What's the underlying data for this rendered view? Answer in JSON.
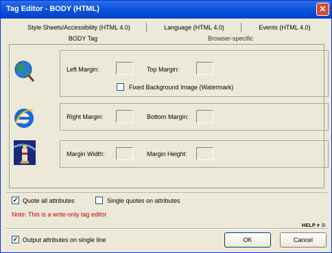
{
  "window": {
    "title": "Tag Editor - BODY   (HTML)"
  },
  "tabs": [
    {
      "label": "Style Sheets/Accessibility (HTML 4.0)"
    },
    {
      "label": "Language (HTML 4.0)"
    },
    {
      "label": "Events (HTML 4.0)"
    }
  ],
  "subtabs": [
    {
      "label": "BODY Tag"
    },
    {
      "label": "Browser-specific"
    }
  ],
  "groups": {
    "margins": {
      "left_margin_label": "Left Margin:",
      "left_margin_value": "",
      "top_margin_label": "Top Margin:",
      "top_margin_value": "",
      "fixed_bg_label": "Fixed Background Image (Watermark)",
      "fixed_bg_checked": false
    },
    "ie": {
      "right_margin_label": "Right Margin:",
      "right_margin_value": "",
      "bottom_margin_label": "Bottom Margin:",
      "bottom_margin_value": ""
    },
    "netscape": {
      "margin_width_label": "Margin Width:",
      "margin_width_value": "",
      "margin_height_label": "Margin Height:",
      "margin_height_value": ""
    }
  },
  "options": {
    "quote_all_label": "Quote all attributes",
    "quote_all_checked": true,
    "single_quotes_label": "Single quotes on attributes",
    "single_quotes_checked": false,
    "note": "Note: This is a write-only tag editor",
    "output_single_line_label": "Output attributes on single line",
    "output_single_line_checked": true
  },
  "help": {
    "label": "HELP ≠ ☉"
  },
  "buttons": {
    "ok": "OK",
    "cancel": "Cancel"
  },
  "colors": {
    "note": "#c00000",
    "titlebar": "#0a53e0"
  }
}
